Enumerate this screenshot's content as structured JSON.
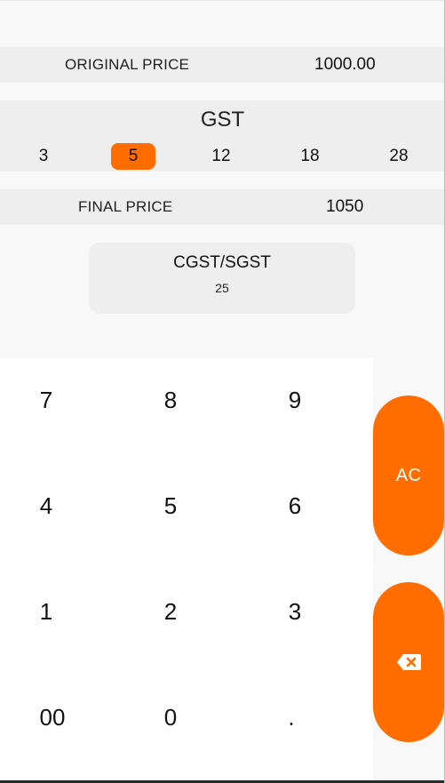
{
  "original_price": {
    "label": "ORIGINAL PRICE",
    "value": "1000.00"
  },
  "gst": {
    "title": "GST",
    "options": [
      "3",
      "5",
      "12",
      "18",
      "28"
    ],
    "selected": "5"
  },
  "final_price": {
    "label": "FINAL PRICE",
    "value": "1050"
  },
  "breakdown": {
    "title": "CGST/SGST",
    "value": "25"
  },
  "keypad": {
    "keys": [
      "7",
      "8",
      "9",
      "4",
      "5",
      "6",
      "1",
      "2",
      "3",
      "00",
      "0",
      "."
    ],
    "ac_label": "AC",
    "backspace_icon": "backspace-icon"
  },
  "colors": {
    "accent": "#ff6d00",
    "row_background": "#eeeeee",
    "page_background": "#f8f8f8",
    "keypad_background": "#ffffff"
  }
}
